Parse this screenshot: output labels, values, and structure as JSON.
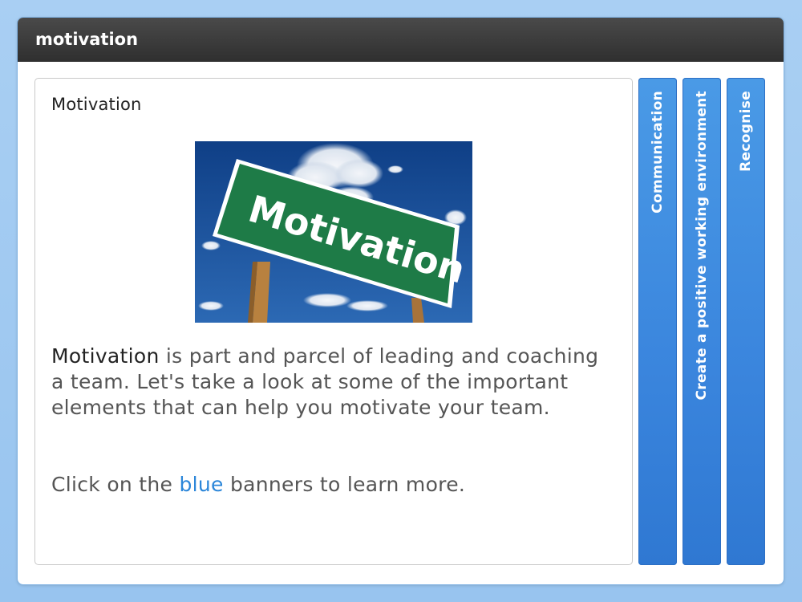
{
  "window": {
    "title": "motivation"
  },
  "content": {
    "heading": "Motivation",
    "image_alt": "Motivation road sign",
    "image_sign_text": "Motivation",
    "body_lead": "Motivation",
    "body_rest": " is part and parcel of leading and coaching a team. Let's take a look at some of the important elements that can help you motivate your team.",
    "instruction_pre": "Click on the ",
    "instruction_blue": "blue",
    "instruction_post": " banners to learn more."
  },
  "banners": [
    {
      "label": "Communication"
    },
    {
      "label": "Create a positive working environment"
    },
    {
      "label": "Recognise"
    }
  ],
  "colors": {
    "accent_blue": "#2b86d9",
    "banner_blue": "#3a85dd",
    "titlebar": "#333333",
    "sign_green": "#1f7a45"
  }
}
